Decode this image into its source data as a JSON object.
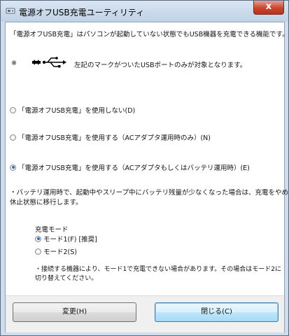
{
  "window": {
    "title": "電源オフUSB充電ユーティリティ",
    "close_label": "x"
  },
  "content": {
    "description": "「電源オフUSB充電」はパソコンが起動していない状態でもUSB機器を充電できる機能です。",
    "note_mark": "※",
    "note_text": "左記のマークがついたUSBポートのみが対象となります。",
    "options": [
      {
        "label": "「電源オフUSB充電」を使用しない(D)",
        "selected": false
      },
      {
        "label": "「電源オフUSB充電」を使用する（ACアダプタ運用時のみ）(N)",
        "selected": false
      },
      {
        "label": "「電源オフUSB充電」を使用する（ACアダプタもしくはバッテリ運用時）(E)",
        "selected": true
      }
    ],
    "battery_note_line1": "・バッテリ運用時で、起動中やスリープ中にバッテリ残量が少なくなった場合は、充電をやめて",
    "battery_note_line2": "休止状態に移行します。",
    "mode_heading": "充電モード",
    "modes": [
      {
        "label": "モード1(F) [推奨]",
        "selected": true
      },
      {
        "label": "モード2(S)",
        "selected": false
      }
    ],
    "mode_note_line1": "・接続する機器により、モード1で充電できない場合があります。その場合はモード2に",
    "mode_note_line2": "切り替えてください。"
  },
  "buttons": {
    "change_label": "変更(H)",
    "close_label": "閉じる(C)"
  }
}
